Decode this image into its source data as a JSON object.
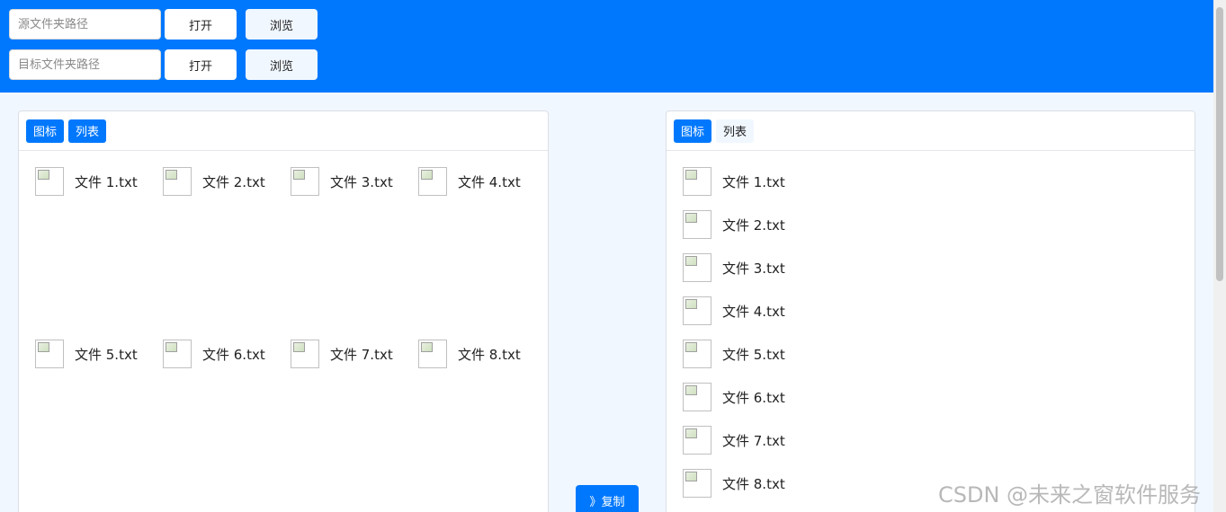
{
  "toolbar": {
    "source": {
      "placeholder": "源文件夹路径",
      "open_label": "打开",
      "browse_label": "浏览"
    },
    "target": {
      "placeholder": "目标文件夹路径",
      "open_label": "打开",
      "browse_label": "浏览"
    }
  },
  "left_panel": {
    "modes": [
      {
        "label": "图标",
        "active": true
      },
      {
        "label": "列表",
        "active": false
      }
    ],
    "view": "icon",
    "files": [
      "文件 1.txt",
      "文件 2.txt",
      "文件 3.txt",
      "文件 4.txt",
      "文件 5.txt",
      "文件 6.txt",
      "文件 7.txt",
      "文件 8.txt"
    ]
  },
  "right_panel": {
    "modes": [
      {
        "label": "图标",
        "active": true
      },
      {
        "label": "列表",
        "active": false
      }
    ],
    "view": "list",
    "files": [
      "文件 1.txt",
      "文件 2.txt",
      "文件 3.txt",
      "文件 4.txt",
      "文件 5.txt",
      "文件 6.txt",
      "文件 7.txt",
      "文件 8.txt"
    ]
  },
  "copy_button": {
    "label": "》复制"
  },
  "watermark": "CSDN @未来之窗软件服务",
  "colors": {
    "primary": "#0078fe",
    "background": "#f0f7ff"
  }
}
